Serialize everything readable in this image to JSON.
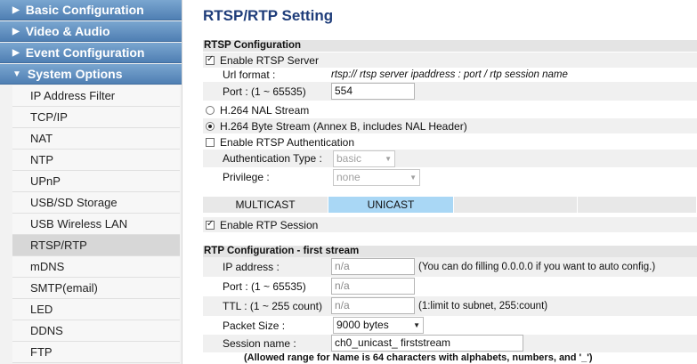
{
  "sidebar": {
    "categories": [
      {
        "label": "Basic Configuration",
        "arrow": "▶"
      },
      {
        "label": "Video & Audio",
        "arrow": "▶"
      },
      {
        "label": "Event Configuration",
        "arrow": "▶"
      },
      {
        "label": "System Options",
        "arrow": "▼"
      }
    ],
    "items": [
      {
        "label": "IP Address Filter"
      },
      {
        "label": "TCP/IP"
      },
      {
        "label": "NAT"
      },
      {
        "label": "NTP"
      },
      {
        "label": "UPnP"
      },
      {
        "label": "USB/SD Storage"
      },
      {
        "label": "USB Wireless LAN"
      },
      {
        "label": "RTSP/RTP",
        "active": true
      },
      {
        "label": "mDNS"
      },
      {
        "label": "SMTP(email)"
      },
      {
        "label": "LED"
      },
      {
        "label": "DDNS"
      },
      {
        "label": "FTP"
      }
    ]
  },
  "main": {
    "title": "RTSP/RTP Setting",
    "rtsp": {
      "heading": "RTSP Configuration",
      "enable_server": "Enable RTSP Server",
      "url_format_label": "Url format :",
      "url_format_value": "rtsp:// rtsp server ipaddress : port / rtp session name",
      "port_label": "Port : (1 ~ 65535)",
      "port_value": "554",
      "nal_stream": "H.264 NAL Stream",
      "byte_stream": "H.264 Byte Stream (Annex B, includes NAL Header)",
      "enable_auth": "Enable RTSP Authentication",
      "auth_type_label": "Authentication Type :",
      "auth_type_value": "basic",
      "privilege_label": "Privilege :",
      "privilege_value": "none"
    },
    "tabs": {
      "multicast": "MULTICAST",
      "unicast": "UNICAST"
    },
    "enable_rtp": "Enable RTP Session",
    "rtp": {
      "heading": "RTP Configuration - first stream",
      "ip_label": "IP address :",
      "ip_value": "n/a",
      "ip_note": "(You can do filling 0.0.0.0 if you want to auto config.)",
      "port_label": "Port : (1 ~ 65535)",
      "port_value": "n/a",
      "ttl_label": "TTL : (1 ~ 255 count)",
      "ttl_value": "n/a",
      "ttl_note": "(1:limit to subnet, 255:count)",
      "packet_label": "Packet Size :",
      "packet_value": "9000 bytes",
      "session_label": "Session name :",
      "session_value": "ch0_unicast_ firststream",
      "name_note": "(Allowed range for Name is 64 characters with alphabets, numbers, and '_')"
    }
  }
}
